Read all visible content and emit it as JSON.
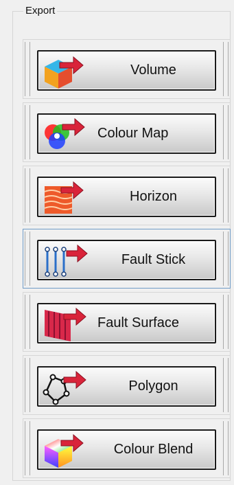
{
  "group": {
    "title": "Export"
  },
  "buttons": [
    {
      "label": "Volume",
      "icon": "volume-cube-icon"
    },
    {
      "label": "Colour Map",
      "icon": "colour-map-icon"
    },
    {
      "label": "Horizon",
      "icon": "horizon-icon"
    },
    {
      "label": "Fault Stick",
      "icon": "fault-stick-icon"
    },
    {
      "label": "Fault Surface",
      "icon": "fault-surface-icon"
    },
    {
      "label": "Polygon",
      "icon": "polygon-icon"
    },
    {
      "label": "Colour Blend",
      "icon": "colour-blend-icon"
    }
  ],
  "colors": {
    "arrow": "#d9243a",
    "selected_border": "#6f9bc7"
  }
}
